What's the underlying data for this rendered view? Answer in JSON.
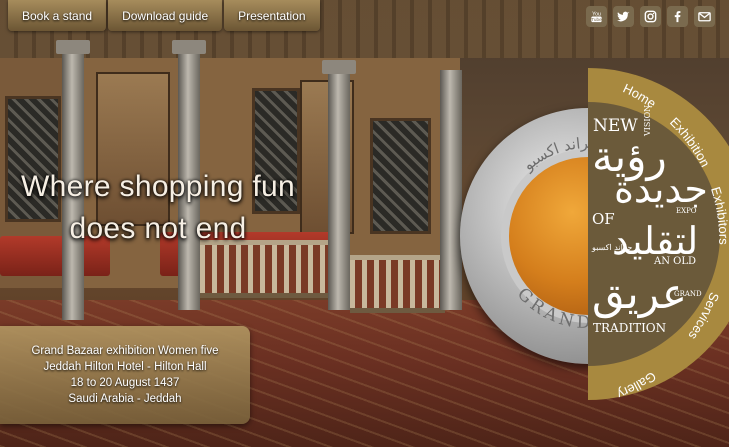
{
  "top_menu": [
    {
      "label": "Book a stand"
    },
    {
      "label": "Download guide"
    },
    {
      "label": "Presentation"
    }
  ],
  "social": [
    {
      "icon": "youtube-icon",
      "name": "YouTube"
    },
    {
      "icon": "twitter-icon",
      "name": "Twitter"
    },
    {
      "icon": "instagram-icon",
      "name": "Instagram"
    },
    {
      "icon": "facebook-icon",
      "name": "Facebook"
    },
    {
      "icon": "mail-icon",
      "name": "Email"
    }
  ],
  "headline": {
    "line1": "Where shopping fun",
    "line2": "does not end"
  },
  "info": {
    "line1": "Grand Bazaar exhibition Women five",
    "line2": "Jeddah Hilton Hotel - Hilton Hall",
    "line3": "18 to 20 August 1437",
    "line4": "Saudi Arabia - Jeddah"
  },
  "nav": {
    "home": "Home",
    "exhibition": "Exhibition",
    "exhibitors": "Exhibitors",
    "services": "Services",
    "gallery": "Gallery"
  },
  "coin": {
    "text": "GRAND EXPO",
    "arabic": "جراند اكسبو"
  },
  "logo": {
    "new": "NEW",
    "vision": "VISION",
    "of": "OF",
    "an_old": "AN OLD",
    "tradition": "TRADITION",
    "expo": "EXPO",
    "grand": "GRAND",
    "arabic_1": "رؤية",
    "arabic_2": "جديدة",
    "arabic_3": "لتقليد",
    "arabic_4": "عريق",
    "arabic_small": "جراند اكسبو"
  },
  "colors": {
    "gold": "#a8893f",
    "wheel_dark": "#6b5a3a",
    "accent_orange": "#d47e1c"
  }
}
